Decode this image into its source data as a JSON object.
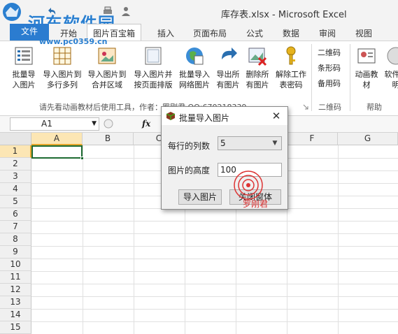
{
  "window": {
    "title": "库存表.xlsx - Microsoft Excel"
  },
  "watermark": {
    "text": "河东软件园",
    "url": "www.pc0359.cn"
  },
  "tabs": [
    {
      "label": "文件"
    },
    {
      "label": "开始"
    },
    {
      "label": "图片百宝箱"
    },
    {
      "label": "插入"
    },
    {
      "label": "页面布局"
    },
    {
      "label": "公式"
    },
    {
      "label": "数据"
    },
    {
      "label": "审阅"
    },
    {
      "label": "视图"
    }
  ],
  "ribbon": {
    "buttons": [
      {
        "label": "批量导入图片",
        "icon": "list-icon"
      },
      {
        "label": "导入图片到多行多列",
        "icon": "grid-icon"
      },
      {
        "label": "导入图片到合并区域",
        "icon": "picture-card-icon"
      },
      {
        "label": "导入图片并按页面排版",
        "icon": "page-icon"
      },
      {
        "label": "批量导入网络图片",
        "icon": "globe-icon"
      },
      {
        "label": "导出所有图片",
        "icon": "export-arrow-icon"
      },
      {
        "label": "删除所有图片",
        "icon": "delete-image-icon"
      },
      {
        "label": "解除工作表密码",
        "icon": "key-icon"
      }
    ],
    "group_label": "请先看动画教材后使用工具，作者：罗刚君 QQ:670218339",
    "barcode_items": [
      "二维码",
      "条形码",
      "备用码"
    ],
    "barcode_group_label": "二维码",
    "help_buttons": [
      {
        "label": "动画教材",
        "icon": "animation-tutorial-icon"
      },
      {
        "label": "软件说明",
        "icon": "help-doc-icon"
      }
    ],
    "help_group_label": "帮助"
  },
  "formula_bar": {
    "name_box": "A1",
    "fx": "fx",
    "content": ""
  },
  "grid": {
    "columns": [
      "A",
      "B",
      "C",
      "D",
      "E",
      "F",
      "G"
    ],
    "rows": [
      "1",
      "2",
      "3",
      "4",
      "5",
      "6",
      "7",
      "8",
      "9",
      "10",
      "11",
      "12",
      "13",
      "14",
      "15"
    ],
    "active_cell": "A1"
  },
  "dialog": {
    "title": "批量导入图片",
    "columns_label": "每行的列数",
    "columns_value": "5",
    "height_label": "图片的高度",
    "height_value": "100",
    "import_button": "导入图片",
    "close_button": "关闭窗体",
    "close_icon": "close-icon",
    "annotation": "罗刚君"
  },
  "colors": {
    "file_tab": "#2b7cd0",
    "accent": "#1e6b32",
    "selection": "#fce6b4",
    "watermark": "#2a7fd0",
    "annotation": "#dd3333"
  }
}
